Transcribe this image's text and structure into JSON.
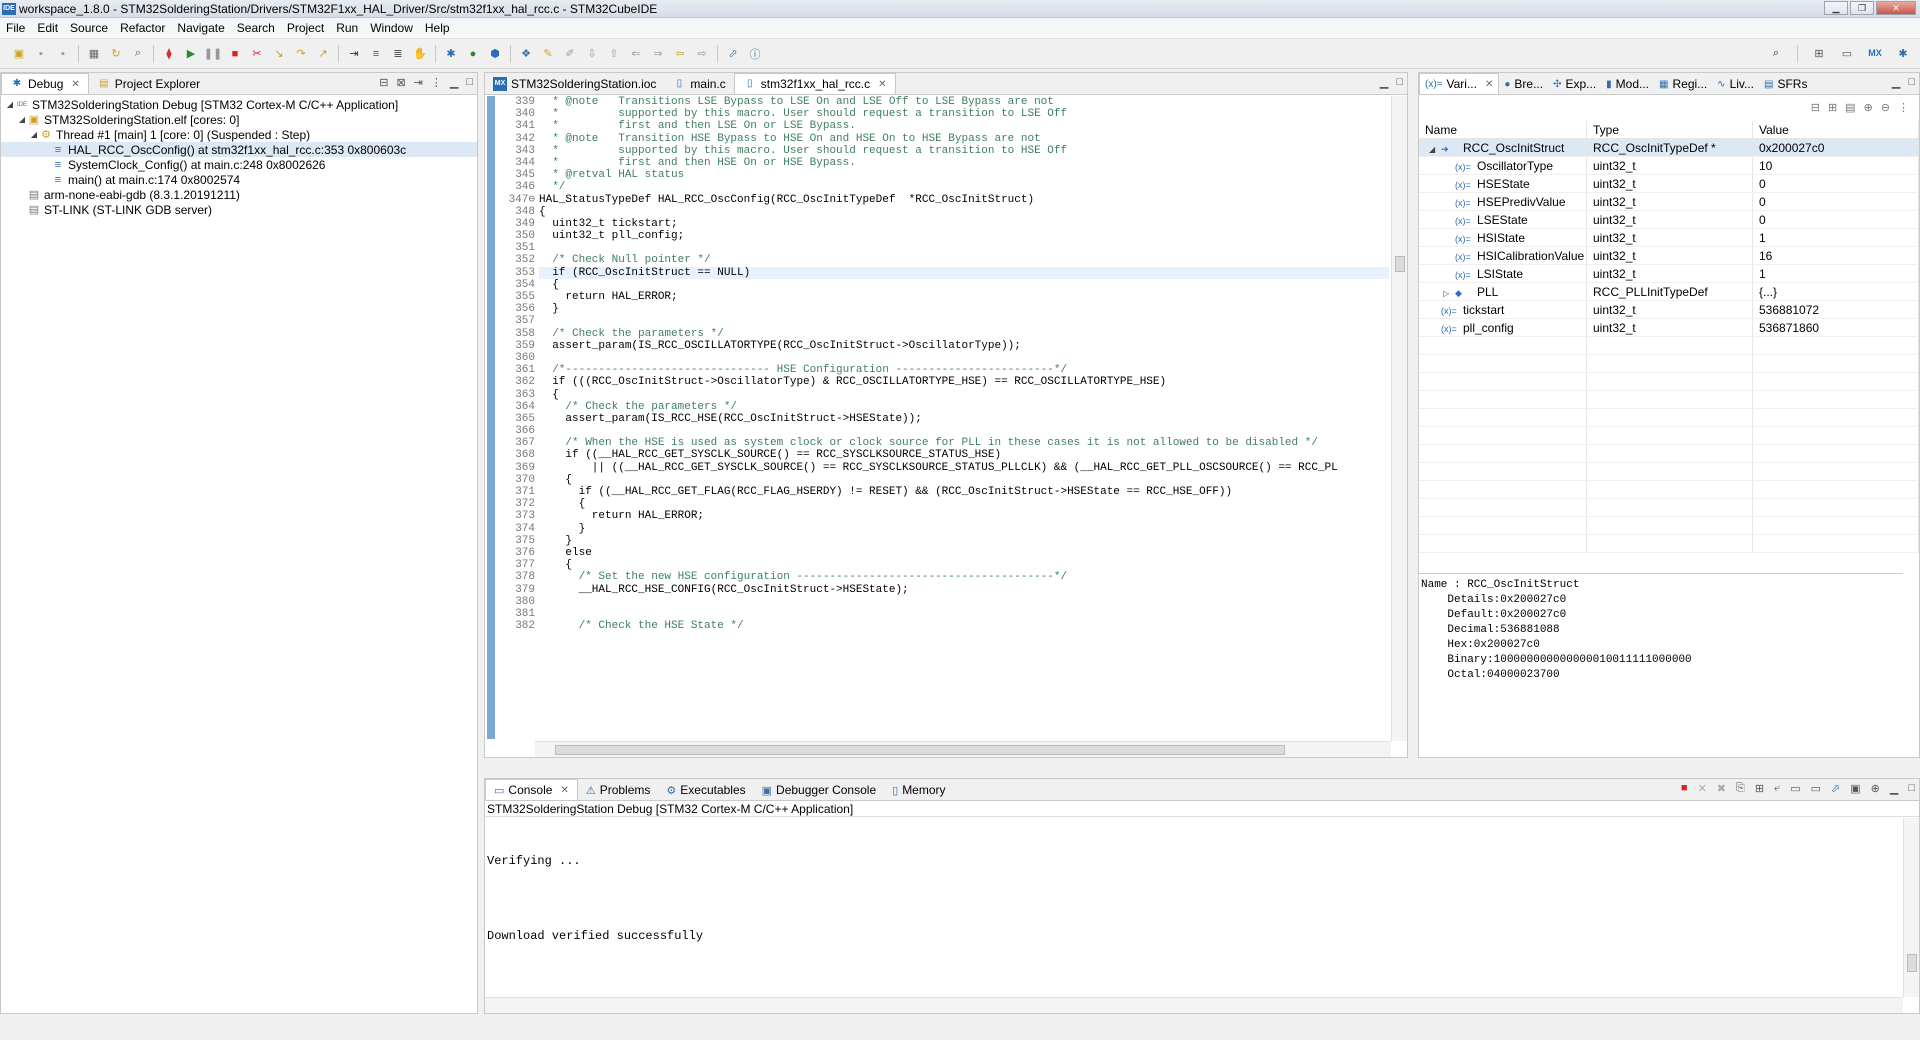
{
  "window": {
    "title": "workspace_1.8.0 - STM32SolderingStation/Drivers/STM32F1xx_HAL_Driver/Src/stm32f1xx_hal_rcc.c - STM32CubeIDE",
    "app_icon": "IDE"
  },
  "menu": [
    "File",
    "Edit",
    "Source",
    "Refactor",
    "Navigate",
    "Search",
    "Project",
    "Run",
    "Window",
    "Help"
  ],
  "debug_view": {
    "tabs": [
      {
        "label": "Debug"
      },
      {
        "label": "Project Explorer"
      }
    ],
    "tree": [
      {
        "level": 0,
        "text": "STM32SolderingStation Debug [STM32 Cortex-M C/C++ Application]",
        "expanded": true,
        "icon": "launch-icon"
      },
      {
        "level": 1,
        "text": "STM32SolderingStation.elf [cores: 0]",
        "expanded": true,
        "icon": "elf-icon"
      },
      {
        "level": 2,
        "text": "Thread #1 [main] 1 [core: 0] (Suspended : Step)",
        "expanded": true,
        "icon": "thread-icon"
      },
      {
        "level": 3,
        "text": "HAL_RCC_OscConfig() at stm32f1xx_hal_rcc.c:353 0x800603c",
        "selected": true,
        "icon": "frame-icon"
      },
      {
        "level": 3,
        "text": "SystemClock_Config() at main.c:248 0x8002626",
        "icon": "frame-icon"
      },
      {
        "level": 3,
        "text": "main() at main.c:174 0x8002574",
        "icon": "frame-icon"
      },
      {
        "level": 1,
        "text": "arm-none-eabi-gdb (8.3.1.20191211)",
        "icon": "gdb-icon"
      },
      {
        "level": 1,
        "text": "ST-LINK (ST-LINK GDB server)",
        "icon": "gdb-icon"
      }
    ]
  },
  "editor": {
    "tabs": [
      {
        "label": "STM32SolderingStation.ioc",
        "icon": "MX"
      },
      {
        "label": "main.c"
      },
      {
        "label": "stm32f1xx_hal_rcc.c",
        "active": true
      }
    ],
    "lines": [
      {
        "n": "339",
        "t": "  * @note   Transitions LSE Bypass to LSE On and LSE Off to LSE Bypass are not",
        "c": "cmt"
      },
      {
        "n": "340",
        "t": "  *         supported by this macro. User should request a transition to LSE Off",
        "c": "cmt"
      },
      {
        "n": "341",
        "t": "  *         first and then LSE On or LSE Bypass.",
        "c": "cmt"
      },
      {
        "n": "342",
        "t": "  * @note   Transition HSE Bypass to HSE On and HSE On to HSE Bypass are not",
        "c": "cmt"
      },
      {
        "n": "343",
        "t": "  *         supported by this macro. User should request a transition to HSE Off",
        "c": "cmt"
      },
      {
        "n": "344",
        "t": "  *         first and then HSE On or HSE Bypass.",
        "c": "cmt"
      },
      {
        "n": "345",
        "t": "  * @retval HAL status",
        "c": "cmt"
      },
      {
        "n": "346",
        "t": "  */",
        "c": "cmt"
      },
      {
        "n": "347⊖",
        "t": "HAL_StatusTypeDef HAL_RCC_OscConfig(RCC_OscInitTypeDef  *RCC_OscInitStruct)",
        "c": ""
      },
      {
        "n": "348",
        "t": "{",
        "c": ""
      },
      {
        "n": "349",
        "t": "  uint32_t tickstart;",
        "c": ""
      },
      {
        "n": "350",
        "t": "  uint32_t pll_config;",
        "c": ""
      },
      {
        "n": "351",
        "t": "",
        "c": ""
      },
      {
        "n": "352",
        "t": "  /* Check Null pointer */",
        "c": "cmt"
      },
      {
        "n": "353",
        "t": "  if (RCC_OscInitStruct == NULL)",
        "c": "hl"
      },
      {
        "n": "354",
        "t": "  {",
        "c": ""
      },
      {
        "n": "355",
        "t": "    return HAL_ERROR;",
        "c": ""
      },
      {
        "n": "356",
        "t": "  }",
        "c": ""
      },
      {
        "n": "357",
        "t": "",
        "c": ""
      },
      {
        "n": "358",
        "t": "  /* Check the parameters */",
        "c": "cmt"
      },
      {
        "n": "359",
        "t": "  assert_param(IS_RCC_OSCILLATORTYPE(RCC_OscInitStruct->OscillatorType));",
        "c": ""
      },
      {
        "n": "360",
        "t": "",
        "c": ""
      },
      {
        "n": "361",
        "t": "  /*------------------------------- HSE Configuration ------------------------*/",
        "c": "cmt"
      },
      {
        "n": "362",
        "t": "  if (((RCC_OscInitStruct->OscillatorType) & RCC_OSCILLATORTYPE_HSE) == RCC_OSCILLATORTYPE_HSE)",
        "c": ""
      },
      {
        "n": "363",
        "t": "  {",
        "c": ""
      },
      {
        "n": "364",
        "t": "    /* Check the parameters */",
        "c": "cmt"
      },
      {
        "n": "365",
        "t": "    assert_param(IS_RCC_HSE(RCC_OscInitStruct->HSEState));",
        "c": ""
      },
      {
        "n": "366",
        "t": "",
        "c": ""
      },
      {
        "n": "367",
        "t": "    /* When the HSE is used as system clock or clock source for PLL in these cases it is not allowed to be disabled */",
        "c": "cmt"
      },
      {
        "n": "368",
        "t": "    if ((__HAL_RCC_GET_SYSCLK_SOURCE() == RCC_SYSCLKSOURCE_STATUS_HSE)",
        "c": ""
      },
      {
        "n": "369",
        "t": "        || ((__HAL_RCC_GET_SYSCLK_SOURCE() == RCC_SYSCLKSOURCE_STATUS_PLLCLK) && (__HAL_RCC_GET_PLL_OSCSOURCE() == RCC_PL",
        "c": ""
      },
      {
        "n": "370",
        "t": "    {",
        "c": ""
      },
      {
        "n": "371",
        "t": "      if ((__HAL_RCC_GET_FLAG(RCC_FLAG_HSERDY) != RESET) && (RCC_OscInitStruct->HSEState == RCC_HSE_OFF))",
        "c": ""
      },
      {
        "n": "372",
        "t": "      {",
        "c": ""
      },
      {
        "n": "373",
        "t": "        return HAL_ERROR;",
        "c": ""
      },
      {
        "n": "374",
        "t": "      }",
        "c": ""
      },
      {
        "n": "375",
        "t": "    }",
        "c": ""
      },
      {
        "n": "376",
        "t": "    else",
        "c": ""
      },
      {
        "n": "377",
        "t": "    {",
        "c": ""
      },
      {
        "n": "378",
        "t": "      /* Set the new HSE configuration ---------------------------------------*/",
        "c": "cmt"
      },
      {
        "n": "379",
        "t": "      __HAL_RCC_HSE_CONFIG(RCC_OscInitStruct->HSEState);",
        "c": ""
      },
      {
        "n": "380",
        "t": "",
        "c": ""
      },
      {
        "n": "381",
        "t": "",
        "c": ""
      },
      {
        "n": "382",
        "t": "      /* Check the HSE State */",
        "c": "cmt"
      }
    ]
  },
  "variables_view": {
    "tabs": [
      {
        "label": "Vari...",
        "icon": "(x)="
      },
      {
        "label": "Bre...",
        "icon": "●"
      },
      {
        "label": "Exp...",
        "icon": "✣"
      },
      {
        "label": "Mod...",
        "icon": "▮"
      },
      {
        "label": "Regi...",
        "icon": "▦"
      },
      {
        "label": "Liv...",
        "icon": "∿"
      },
      {
        "label": "SFRs",
        "icon": "▤"
      }
    ],
    "columns": [
      "Name",
      "Type",
      "Value"
    ],
    "rows": [
      {
        "indent": 0,
        "twisty": "◢",
        "icon": "➜",
        "name": "RCC_OscInitStruct",
        "type": "RCC_OscInitTypeDef *",
        "value": "0x200027c0",
        "selected": true
      },
      {
        "indent": 1,
        "icon": "(x)=",
        "name": "OscillatorType",
        "type": "uint32_t",
        "value": "10"
      },
      {
        "indent": 1,
        "icon": "(x)=",
        "name": "HSEState",
        "type": "uint32_t",
        "value": "0"
      },
      {
        "indent": 1,
        "icon": "(x)=",
        "name": "HSEPredivValue",
        "type": "uint32_t",
        "value": "0"
      },
      {
        "indent": 1,
        "icon": "(x)=",
        "name": "LSEState",
        "type": "uint32_t",
        "value": "0"
      },
      {
        "indent": 1,
        "icon": "(x)=",
        "name": "HSIState",
        "type": "uint32_t",
        "value": "1"
      },
      {
        "indent": 1,
        "icon": "(x)=",
        "name": "HSICalibrationValue",
        "type": "uint32_t",
        "value": "16"
      },
      {
        "indent": 1,
        "icon": "(x)=",
        "name": "LSIState",
        "type": "uint32_t",
        "value": "1"
      },
      {
        "indent": 1,
        "twisty": "▷",
        "icon": "◆",
        "name": "PLL",
        "type": "RCC_PLLInitTypeDef",
        "value": "{...}"
      },
      {
        "indent": 0,
        "icon": "(x)=",
        "name": "tickstart",
        "type": "uint32_t",
        "value": "536881072"
      },
      {
        "indent": 0,
        "icon": "(x)=",
        "name": "pll_config",
        "type": "uint32_t",
        "value": "536871860"
      }
    ],
    "details": [
      "Name : RCC_OscInitStruct",
      "    Details:0x200027c0",
      "    Default:0x200027c0",
      "    Decimal:536881088",
      "    Hex:0x200027c0",
      "    Binary:100000000000000010011111000000",
      "    Octal:04000023700"
    ]
  },
  "console": {
    "tabs": [
      {
        "label": "Console",
        "icon": "▭",
        "active": true
      },
      {
        "label": "Problems",
        "icon": "⚠"
      },
      {
        "label": "Executables",
        "icon": "⚙"
      },
      {
        "label": "Debugger Console",
        "icon": "▣"
      },
      {
        "label": "Memory",
        "icon": "▯"
      }
    ],
    "header": "STM32SolderingStation Debug [STM32 Cortex-M C/C++ Application]",
    "lines": [
      "Verifying ...",
      "Download verified successfully"
    ]
  }
}
